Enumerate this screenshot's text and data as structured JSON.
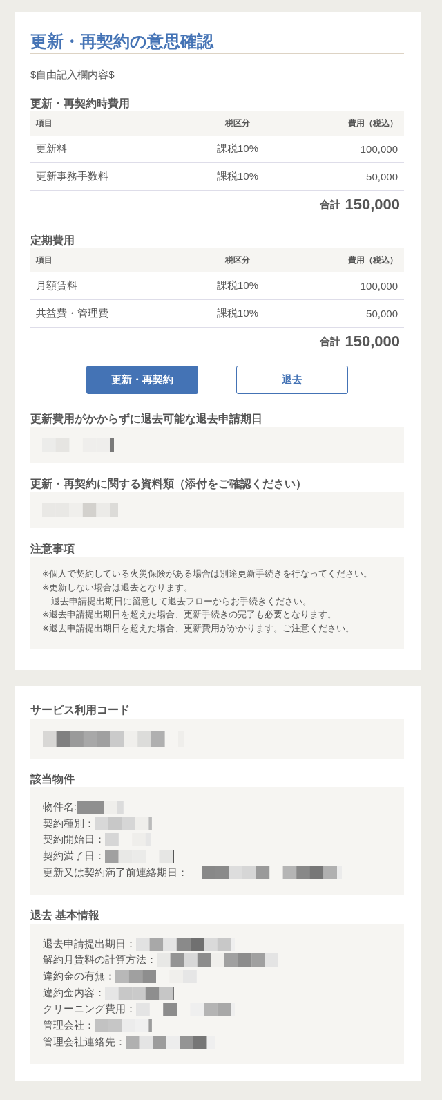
{
  "title": "更新・再契約の意思確認",
  "free_text": "$自由記入欄内容$",
  "fee_tables": [
    {
      "title": "更新・再契約時費用",
      "columns": [
        "項目",
        "税区分",
        "費用（税込）"
      ],
      "rows": [
        [
          "更新料",
          "課税10%",
          "100,000"
        ],
        [
          "更新事務手数料",
          "課税10%",
          "50,000"
        ]
      ],
      "total_label": "合計",
      "total": "150,000"
    },
    {
      "title": "定期費用",
      "columns": [
        "項目",
        "税区分",
        "費用（税込）"
      ],
      "rows": [
        [
          "月額賃料",
          "課税10%",
          "100,000"
        ],
        [
          "共益費・管理費",
          "課税10%",
          "50,000"
        ]
      ],
      "total_label": "合計",
      "total": "150,000"
    }
  ],
  "buttons": [
    {
      "label": "更新・再契約",
      "kind": "primary"
    },
    {
      "label": "退去",
      "kind": "secondary"
    }
  ],
  "info_fields": [
    {
      "title": "更新費用がかからずに退去可能な退去申請期日",
      "redacted": true
    },
    {
      "title": "更新・再契約に関する資料類（添付をご確認ください）",
      "redacted": true
    }
  ],
  "notes": {
    "title": "注意事項",
    "lines": [
      {
        "kind": "item",
        "text": "※個人で契約している火災保険がある場合は別途更新手続きを行なってください。"
      },
      {
        "kind": "item",
        "text": "※更新しない場合は退去となります。"
      },
      {
        "kind": "continuation",
        "text": "退去申請提出期日に留意して退去フローからお手続きください。"
      },
      {
        "kind": "item",
        "text": "※退去申請提出期日を超えた場合、更新手続きの完了も必要となります。"
      },
      {
        "kind": "item",
        "text": "※退去申請提出期日を超えた場合、更新費用がかかります。ご注意ください。"
      }
    ]
  },
  "details": [
    {
      "title": "サービス利用コード",
      "kind": "value",
      "redacted": true
    },
    {
      "title": "該当物件",
      "kind": "list",
      "items": [
        {
          "label": "物件名:",
          "redacted": true
        },
        {
          "label": "契約種別：",
          "redacted": true
        },
        {
          "label": "契約開始日：",
          "redacted": true
        },
        {
          "label": "契約満了日：",
          "redacted": true
        },
        {
          "label": "更新又は契約満了前連絡期日：",
          "redacted": true
        }
      ]
    },
    {
      "title": "退去 基本情報",
      "kind": "list",
      "items": [
        {
          "label": "退去申請提出期日：",
          "redacted": true
        },
        {
          "label": "解約月賃料の計算方法：",
          "redacted": true
        },
        {
          "label": "違約金の有無：",
          "redacted": true
        },
        {
          "label": "違約金内容：",
          "redacted": true
        },
        {
          "label": "クリーニング費用：",
          "redacted": true
        },
        {
          "label": "管理会社：",
          "redacted": true
        },
        {
          "label": "管理会社連絡先：",
          "redacted": true
        }
      ]
    }
  ]
}
